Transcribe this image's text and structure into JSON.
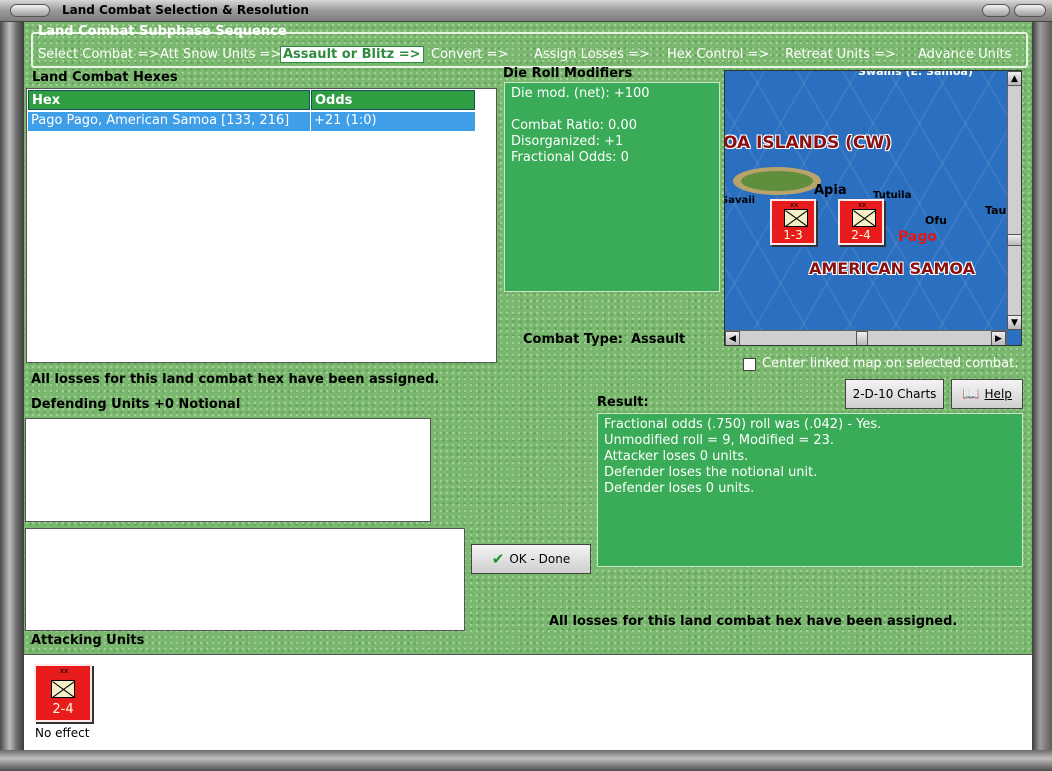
{
  "window": {
    "title": "Land Combat Selection & Resolution"
  },
  "subphase": {
    "title": "Land Combat Subphase Sequence",
    "steps": [
      "Select Combat =>",
      "Att Snow Units =>",
      "Assault or Blitz =>",
      "Convert =>",
      "Assign Losses =>",
      "Hex Control =>",
      "Retreat Units =>",
      "Advance Units"
    ],
    "active_index": 2
  },
  "hexes": {
    "label": "Land Combat Hexes",
    "columns": [
      "Hex",
      "Odds"
    ],
    "rows": [
      {
        "hex": "Pago Pago, American Samoa [133, 216]",
        "odds": "+21 (1:0)"
      }
    ]
  },
  "modifiers": {
    "label": "Die Roll Modifiers",
    "lines": [
      "Die mod. (net): +100",
      "",
      "Combat Ratio: 0.00",
      "Disorganized: +1",
      "Fractional Odds: 0"
    ]
  },
  "combat_type": {
    "label": "Combat Type:",
    "value": "Assault"
  },
  "map": {
    "labels": [
      "Swains (E. Samoa)",
      "OA ISLANDS (CW)",
      "Apia",
      "Savaii",
      "Tutuila",
      "Ofu",
      "Tau",
      "Pago",
      "AMERICAN SAMOA"
    ],
    "units": [
      {
        "value": "1-3",
        "size": "xx"
      },
      {
        "value": "2-4",
        "size": "xx"
      }
    ]
  },
  "center_linked": {
    "label": "Center linked map on selected combat.",
    "checked": false
  },
  "buttons": {
    "charts": "2-D-10 Charts",
    "help": "Help",
    "ok": "OK - Done"
  },
  "losses_assigned_top": "All losses for this land combat hex have been assigned.",
  "losses_assigned_bottom": "All losses for this land combat hex have been assigned.",
  "defending_label": "Defending Units +0 Notional",
  "result": {
    "label": "Result:",
    "lines": [
      "Fractional odds (.750) roll was (.042)  - Yes.",
      "Unmodified roll = 9, Modified = 23.",
      "Attacker loses 0 units.",
      "Defender loses the notional unit.",
      "Defender loses 0 units."
    ]
  },
  "attacking": {
    "label": "Attacking Units",
    "units": [
      {
        "value": "2-4",
        "size": "xx",
        "status": "No effect"
      }
    ]
  },
  "colors": {
    "panel_green": "#3aab56",
    "unit_red": "#e81c1c",
    "selection_blue": "#3f9ee8"
  },
  "icons": [
    "checkmark-icon",
    "book-icon",
    "infantry-symbol"
  ]
}
